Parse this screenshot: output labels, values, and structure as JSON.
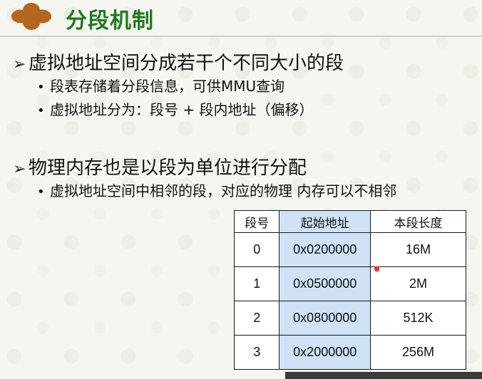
{
  "title": "分段机制",
  "sections": [
    {
      "heading": "虚拟地址空间分成若干个不同大小的段",
      "items": [
        "段表存储着分段信息，可供MMU查询",
        "虚拟地址分为：段号 + 段内地址（偏移）"
      ]
    },
    {
      "heading": "物理内存也是以段为单位进行分配",
      "items": [
        "虚拟地址空间中相邻的段，对应的物理 内存可以不相邻"
      ]
    }
  ],
  "table": {
    "headers": [
      "段号",
      "起始地址",
      "本段长度"
    ],
    "rows": [
      [
        "0",
        "0x0200000",
        "16M"
      ],
      [
        "1",
        "0x0500000",
        "2M"
      ],
      [
        "2",
        "0x0800000",
        "512K"
      ],
      [
        "3",
        "0x2000000",
        "256M"
      ]
    ]
  },
  "colors": {
    "title": "#1f7a1f",
    "logo": "#b5651d",
    "address_column_fill": "#cfe2f6"
  },
  "icons": {
    "logo": "quatrefoil-logo-icon",
    "cursor": "red-laser-pointer-icon"
  }
}
